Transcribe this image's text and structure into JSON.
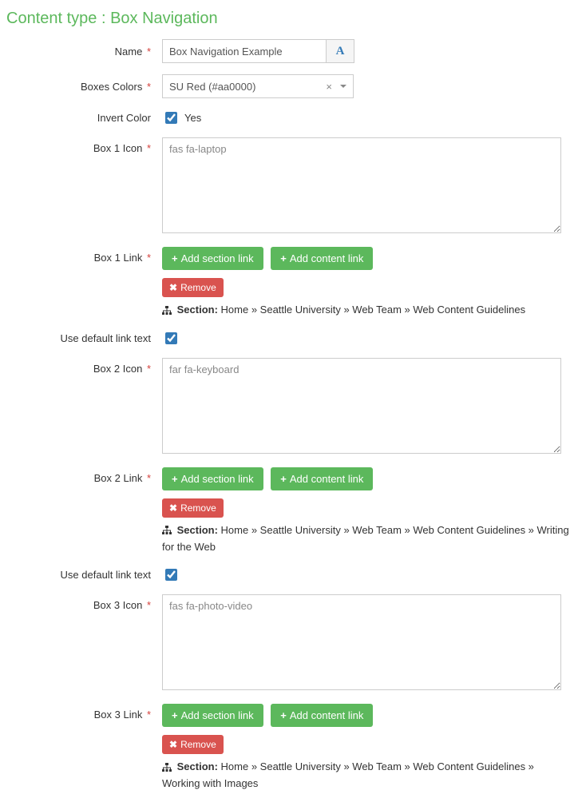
{
  "header": {
    "title": "Content type : Box Navigation"
  },
  "labels": {
    "name": "Name",
    "boxes_colors": "Boxes Colors",
    "invert_color": "Invert Color",
    "box1_icon": "Box 1 Icon",
    "box1_link": "Box 1 Link",
    "use_default_link_text": "Use default link text",
    "box2_icon": "Box 2 Icon",
    "box2_link": "Box 2 Link",
    "box3_icon": "Box 3 Icon",
    "box3_link": "Box 3 Link"
  },
  "buttons": {
    "add_section_link": "Add section link",
    "add_content_link": "Add content link",
    "remove": "Remove"
  },
  "ui": {
    "section_prefix": "Section:",
    "yes": "Yes",
    "format_btn": "A"
  },
  "values": {
    "name": "Box Navigation Example",
    "boxes_colors": "SU Red (#aa0000)",
    "invert_color": true,
    "box1_icon": "fas fa-laptop",
    "box1_crumb": "Home » Seattle University » Web Team » Web Content Guidelines",
    "use_default_1": true,
    "box2_icon": "far fa-keyboard",
    "box2_crumb": "Home » Seattle University » Web Team » Web Content Guidelines » Writing for the Web",
    "use_default_2": true,
    "box3_icon": "fas fa-photo-video",
    "box3_crumb": "Home » Seattle University » Web Team » Web Content Guidelines » Working with Images"
  }
}
